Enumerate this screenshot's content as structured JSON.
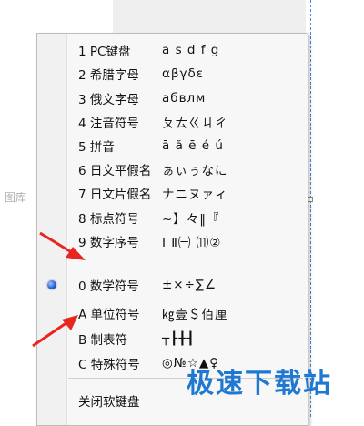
{
  "background": {
    "side_label": "图库"
  },
  "menu": {
    "items": [
      {
        "label": "1 PC键盘",
        "sample": "a s d f g"
      },
      {
        "label": "2 希腊字母",
        "sample": "αβγδε"
      },
      {
        "label": "3 俄文字母",
        "sample": "абвлм"
      },
      {
        "label": "4 注音符号",
        "sample": "ㄆㄊㄍㄐㄔ"
      },
      {
        "label": "5 拼音",
        "sample": "ā ă ē é ú"
      },
      {
        "label": "6 日文平假名",
        "sample": "ぁぃぅなに"
      },
      {
        "label": "7 日文片假名",
        "sample": "ナニヌァィ"
      },
      {
        "label": "8 标点符号",
        "sample": "~】々‖『"
      },
      {
        "label": "9 数字序号",
        "sample": "Ⅰ Ⅱ㈠ ⑾②"
      },
      {
        "label": "0 数学符号",
        "sample": "±×÷∑∠",
        "selected": true
      },
      {
        "label": "A 单位符号",
        "sample": "㎏壹＄佰厘"
      },
      {
        "label": "B 制表符",
        "sample": "┬┠╂┨"
      },
      {
        "label": "C 特殊符号",
        "sample": "◎№☆▲♀"
      }
    ],
    "close_label": "关闭软键盘"
  },
  "watermark": "极速下载站",
  "colors": {
    "arrow": "#e8251f",
    "watermark": "#1f79d1",
    "radio": "#2a5fd6"
  }
}
